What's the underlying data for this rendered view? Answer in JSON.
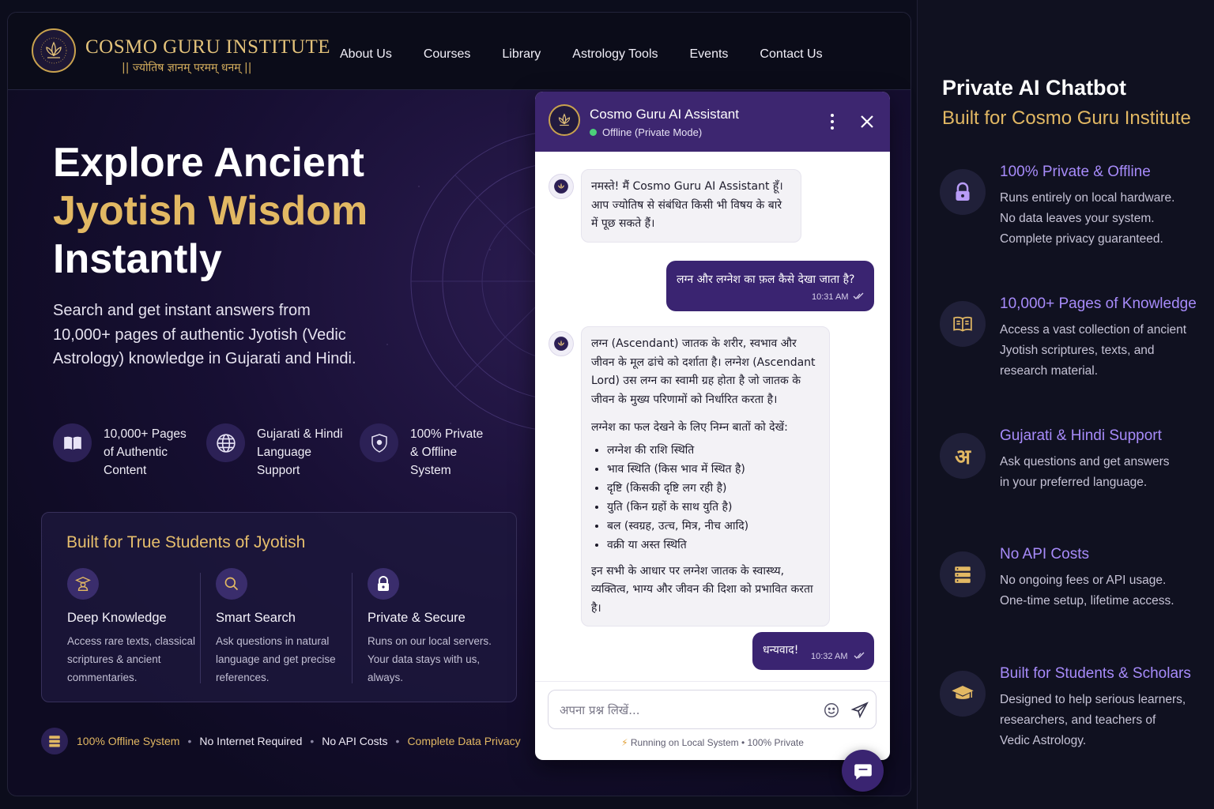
{
  "brand": {
    "name": "COSMO GURU INSTITUTE",
    "tagline": "|| ज्योतिष ज्ञानम् परमम् धनम् ||"
  },
  "nav": [
    "About Us",
    "Courses",
    "Library",
    "Astrology Tools",
    "Events",
    "Contact Us"
  ],
  "hero": {
    "line1": "Explore Ancient",
    "line2": "Jyotish Wisdom",
    "line3": "Instantly",
    "description": "Search and get instant answers from 10,000+ pages of authentic Jyotish (Vedic Astrology) knowledge in Gujarati and Hindi."
  },
  "features": [
    {
      "icon": "book-icon",
      "text": "10,000+ Pages\nof Authentic\nContent"
    },
    {
      "icon": "globe-icon",
      "text": "Gujarati & Hindi\nLanguage\nSupport"
    },
    {
      "icon": "shield-icon",
      "text": "100% Private\n& Offline\nSystem"
    }
  ],
  "built": {
    "title": "Built for True Students of Jyotish",
    "items": [
      {
        "icon": "scholar-icon",
        "title": "Deep Knowledge",
        "desc": "Access rare texts, classical scriptures & ancient commentaries."
      },
      {
        "icon": "search-icon",
        "title": "Smart Search",
        "desc": "Ask questions in natural language and get precise references."
      },
      {
        "icon": "lock-icon",
        "title": "Private & Secure",
        "desc": "Runs on our local servers. Your data stays with us, always."
      }
    ]
  },
  "footer_strip": {
    "icon": "server-icon",
    "item1": "100% Offline System",
    "item2": "No Internet Required",
    "item3": "No API Costs",
    "item4": "Complete Data Privacy"
  },
  "chat": {
    "name": "Cosmo Guru AI Assistant",
    "status": "Offline (Private Mode)",
    "messages": {
      "bot1": "नमस्ते! मैं Cosmo Guru AI Assistant हूँ।\nआप ज्योतिष से संबंधित किसी भी विषय के बारे में पूछ सकते हैं।",
      "user1": "लग्न और लग्नेश का फ़ल कैसे देखा जाता है?",
      "user1_time": "10:31 AM",
      "bot2_intro": "लग्न (Ascendant) जातक के शरीर, स्वभाव और जीवन के मूल ढांचे को दर्शाता है। लग्नेश (Ascendant Lord) उस लग्न का स्वामी ग्रह होता है जो जातक के जीवन के मुख्य परिणामों को निर्धारित करता है।",
      "bot2_lead": "लग्नेश का फल देखने के लिए निम्न बातों को देखें:",
      "bot2_points": [
        "लग्नेश की राशि स्थिति",
        "भाव स्थिति (किस भाव में स्थित है)",
        "दृष्टि (किसकी दृष्टि लग रही है)",
        "युति (किन ग्रहों के साथ युति है)",
        "बल (स्वग्रह, उत्च, मित्र, नीच आदि)",
        "वक्री या अस्त स्थिति"
      ],
      "bot2_outro": "इन सभी के आधार पर लग्नेश जातक के स्वास्थ्य, व्यक्तित्व, भाग्य और जीवन की दिशा को प्रभावित करता है।",
      "user2": "धन्यवाद!",
      "user2_time": "10:32 AM"
    },
    "input_placeholder": "अपना प्रश्न लिखें...",
    "footer": "Running on Local System • 100% Private"
  },
  "side": {
    "title": "Private AI Chatbot",
    "subtitle": "Built for Cosmo Guru Institute",
    "items": [
      {
        "icon": "lock-icon",
        "title": "100% Private & Offline",
        "desc": "Runs entirely on local hardware.\nNo data leaves your system.\nComplete privacy guaranteed."
      },
      {
        "icon": "book-icon",
        "title": "10,000+ Pages of Knowledge",
        "desc": "Access a vast collection of ancient\nJyotish scriptures, texts, and\nresearch material."
      },
      {
        "icon": "language-icon",
        "title": "Gujarati & Hindi Support",
        "desc": "Ask questions and get answers\nin your preferred language."
      },
      {
        "icon": "server-icon",
        "title": "No API Costs",
        "desc": "No ongoing fees or API usage.\nOne-time setup, lifetime access."
      },
      {
        "icon": "graduation-cap-icon",
        "title": "Built for Students & Scholars",
        "desc": "Designed to help serious learners,\nresearchers, and teachers of\nVedic Astrology."
      }
    ]
  },
  "colors": {
    "gold": "#e2b863",
    "purple": "#3d2670",
    "lavender": "#a78bfa"
  }
}
